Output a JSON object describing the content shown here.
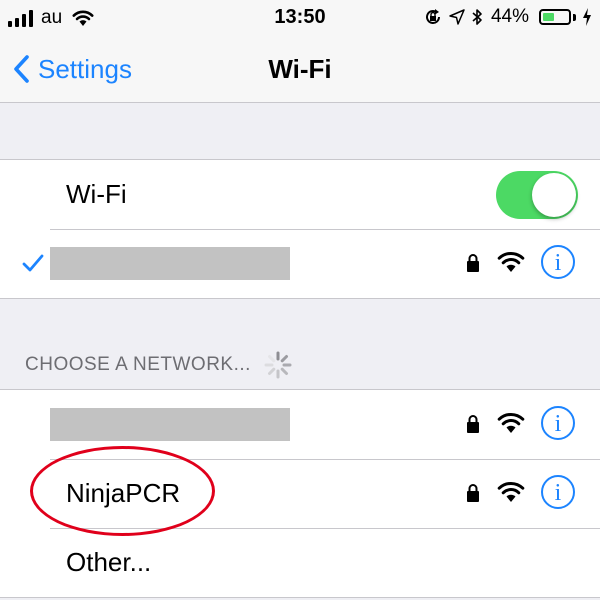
{
  "status_bar": {
    "carrier": "au",
    "time": "13:50",
    "battery_percent": "44%",
    "battery_level": 0.44,
    "icons": [
      "signal-bars-icon",
      "wifi-icon",
      "rotation-lock-icon",
      "location-arrow-icon",
      "bluetooth-icon",
      "battery-icon",
      "charging-bolt-icon"
    ]
  },
  "nav": {
    "back_label": "Settings",
    "title": "Wi-Fi"
  },
  "wifi_toggle": {
    "label": "Wi-Fi",
    "on": true
  },
  "section_header": "CHOOSE A NETWORK...",
  "networks": [
    {
      "label": "NinjaPCR"
    },
    {
      "label": "Other..."
    }
  ],
  "colors": {
    "accent": "#1c84ff",
    "toggle_on": "#4cd964",
    "annotation": "#e0001b",
    "background": "#efeff4"
  }
}
